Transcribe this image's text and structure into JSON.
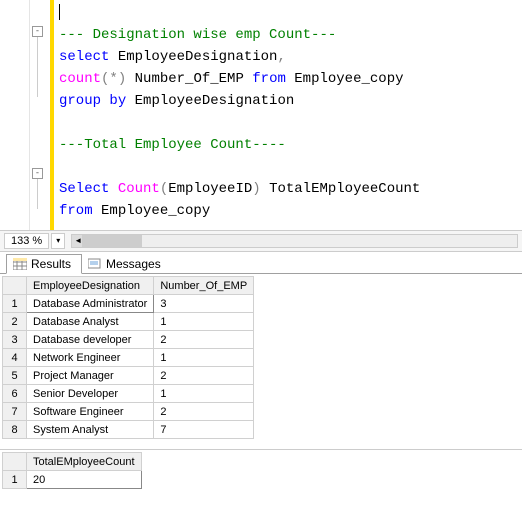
{
  "editor": {
    "comment1": "--- Designation wise emp Count---",
    "line2_select": "select",
    "line2_col": " EmployeeDesignation",
    "line2_comma": ",",
    "line3_count": "count",
    "line3_paren_o": "(",
    "line3_star": "*",
    "line3_paren_c": ")",
    "line3_alias": " Number_Of_EMP ",
    "line3_from": "from",
    "line3_table": " Employee_copy",
    "line4_group": "group",
    "line4_by": "by",
    "line4_col": " EmployeeDesignation",
    "comment2": "---Total Employee Count----",
    "line7_select": "Select",
    "line7_count": "Count",
    "line7_paren_o": "(",
    "line7_col": "EmployeeID",
    "line7_paren_c": ")",
    "line7_alias": " TotalEMployeeCount",
    "line8_from": "from",
    "line8_table": " Employee_copy"
  },
  "zoom": {
    "value": "133 %"
  },
  "tabs": {
    "results": "Results",
    "messages": "Messages"
  },
  "grid1": {
    "headers": {
      "c0": "EmployeeDesignation",
      "c1": "Number_Of_EMP"
    },
    "rows": [
      {
        "n": "1",
        "c0": "Database Administrator",
        "c1": "3"
      },
      {
        "n": "2",
        "c0": "Database Analyst",
        "c1": "1"
      },
      {
        "n": "3",
        "c0": "Database developer",
        "c1": "2"
      },
      {
        "n": "4",
        "c0": "Network Engineer",
        "c1": "1"
      },
      {
        "n": "5",
        "c0": "Project Manager",
        "c1": "2"
      },
      {
        "n": "6",
        "c0": "Senior Developer",
        "c1": "1"
      },
      {
        "n": "7",
        "c0": "Software Engineer",
        "c1": "2"
      },
      {
        "n": "8",
        "c0": "System Analyst",
        "c1": "7"
      }
    ]
  },
  "grid2": {
    "headers": {
      "c0": "TotalEMployeeCount"
    },
    "rows": [
      {
        "n": "1",
        "c0": "20"
      }
    ]
  }
}
